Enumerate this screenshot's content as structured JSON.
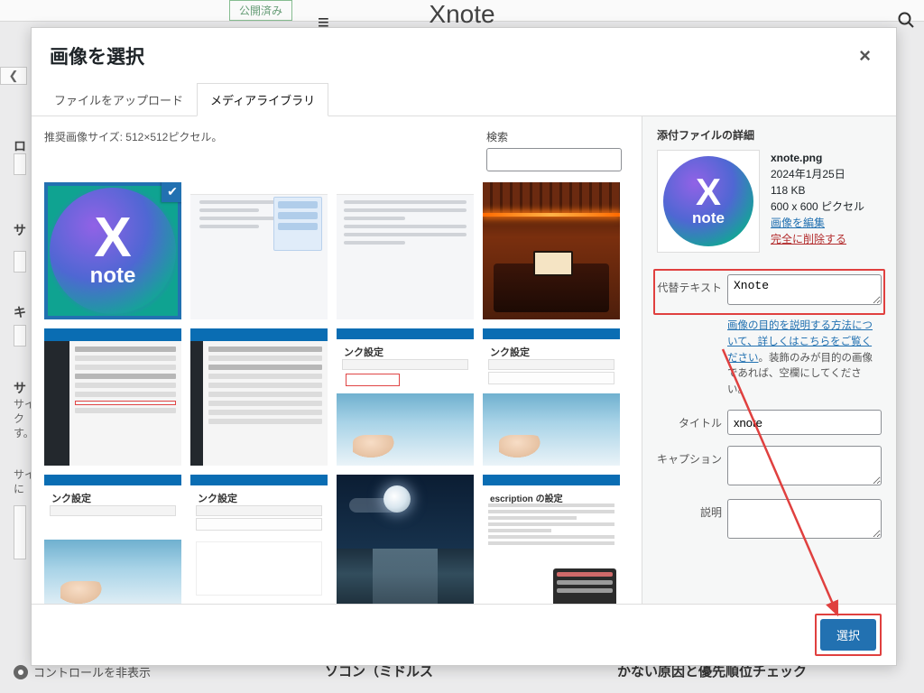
{
  "bg": {
    "published_btn": "公開済み",
    "site_title": "Xnote",
    "controls_hide": "コントロールを非表示",
    "article_left": "けのおすすめ自作パソコン（ミドルス",
    "article_right": "かない原因と優先順位チェック",
    "letters": {
      "a": "ロ",
      "b": "サ",
      "c": "キ",
      "d": "サ"
    },
    "side_text_1": "サイ",
    "side_text_2": "ク",
    "side_text_3": "す。",
    "side_text_4": "サイ",
    "side_text_5": "に"
  },
  "modal": {
    "title": "画像を選択",
    "close": "×",
    "tabs": {
      "upload": "ファイルをアップロード",
      "library": "メディアライブラリ"
    },
    "size_hint": "推奨画像サイズ: 512×512ピクセル。",
    "search_label": "検索",
    "search_value": ""
  },
  "details": {
    "heading": "添付ファイルの詳細",
    "filename": "xnote.png",
    "date": "2024年1月25日",
    "filesize": "118 KB",
    "dimensions": "600 x 600 ピクセル",
    "edit_image": "画像を編集",
    "delete": "完全に削除する",
    "alt_label": "代替テキスト",
    "alt_value": "Xnote",
    "alt_help_link": "画像の目的を説明する方法について、詳しくはこちらをご覧ください",
    "alt_help_rest": "。装飾のみが目的の画像であれば、空欄にしてください。",
    "title_label": "タイトル",
    "title_value": "xnote",
    "caption_label": "キャプション",
    "caption_value": "",
    "desc_label": "説明",
    "desc_value": ""
  },
  "footer": {
    "select": "選択"
  },
  "thumbs": {
    "link_settings_title": "ンク設定",
    "description_title": "escription の設定"
  }
}
